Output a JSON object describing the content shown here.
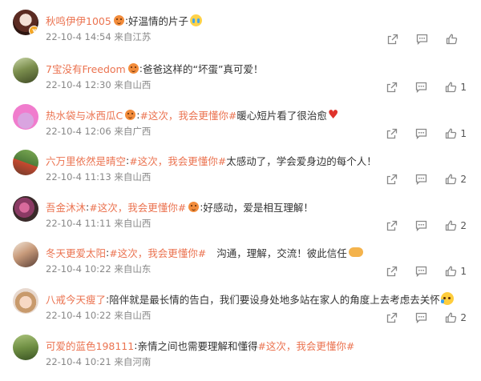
{
  "comments": [
    {
      "username": "秋鸣伊伊1005",
      "topic": "",
      "text": "好温情的片子",
      "emoji": "cry-face-emoji",
      "time": "22-10-4 14:54",
      "location": "来自江苏",
      "likes": ""
    },
    {
      "username": "7宝没有Freedom",
      "topic": "",
      "text": "爸爸这样的“坏蛋”真可爱！",
      "emoji": "",
      "time": "22-10-4 12:30",
      "location": "来自山西",
      "likes": "1"
    },
    {
      "username": "热水袋与冰西瓜C",
      "topic": "#这次，我会更懂你#",
      "text": "暖心短片看了很治愈",
      "emoji": "red-heart-emoji",
      "time": "22-10-4 12:06",
      "location": "来自广西",
      "likes": "1"
    },
    {
      "username": "六万里依然是晴空",
      "topic": "#这次，我会更懂你#",
      "text": "太感动了，学会爱身边的每个人！",
      "emoji": "",
      "time": "22-10-4 11:13",
      "location": "来自山西",
      "likes": "2"
    },
    {
      "username": "吾金沐沐",
      "topic": "#这次，我会更懂你#",
      "text": "好感动，爱是相互理解！",
      "emoji": "",
      "time": "22-10-4 11:11",
      "location": "来自山西",
      "likes": "2"
    },
    {
      "username": "冬天更爱太阳",
      "topic": "#这次，我会更懂你#",
      "text": "沟通，理解，交流！彼此信任",
      "emoji": "handshake-emoji",
      "time": "22-10-4 10:22",
      "location": "来自山东",
      "likes": "1"
    },
    {
      "username": "八戒今天瘦了",
      "topic": "",
      "text": "陪伴就是最长情的告白，我们要设身处地多站在家人的角度上去考虑去关怀",
      "emoji": "sad-face-emoji",
      "time": "22-10-4 10:22",
      "location": "来自山西",
      "likes": "2"
    },
    {
      "username": "可爱的蓝色198111",
      "topic": "#这次，我会更懂你#",
      "text": "亲情之间也需要理解和懂得",
      "emoji": "",
      "time": "22-10-4 10:21",
      "location": "来自河南",
      "likes": ""
    }
  ],
  "colors": {
    "username": "#eb7350",
    "topic": "#eb7350",
    "meta": "#888888",
    "text": "#333333"
  }
}
